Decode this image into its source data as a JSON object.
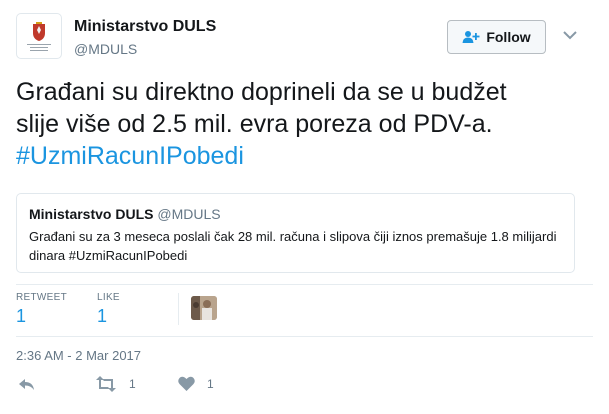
{
  "profile": {
    "name": "Ministarstvo DULS",
    "handle": "@MDULS"
  },
  "follow_button": {
    "label": "Follow",
    "icon": "follow-user-icon"
  },
  "tweet": {
    "text_line1": "Građani su direktno doprineli da se u budžet",
    "text_line2": "slije više od 2.5 mil. evra poreza od PDV-a.",
    "hashtag": "#UzmiRacunIPobedi"
  },
  "quoted_tweet": {
    "name": "Ministarstvo DULS",
    "handle": "@MDULS",
    "body": "Građani su za 3 meseca poslali čak 28 mil. računa i slipova čiji iznos premašuje 1.8 milijardi dinara #UzmiRacunIPobedi"
  },
  "stats": {
    "retweet_label": "RETWEET",
    "retweet_count": "1",
    "like_label": "LIKE",
    "like_count": "1"
  },
  "timestamp": "2:36 AM - 2 Mar 2017",
  "actions": {
    "reply_icon": "reply-icon",
    "retweet_icon": "retweet-icon",
    "retweet_count": "1",
    "like_icon": "heart-icon",
    "like_count": "1"
  },
  "colors": {
    "link": "#1b95e0",
    "secondary": "#657786",
    "border": "#e1e8ed"
  }
}
